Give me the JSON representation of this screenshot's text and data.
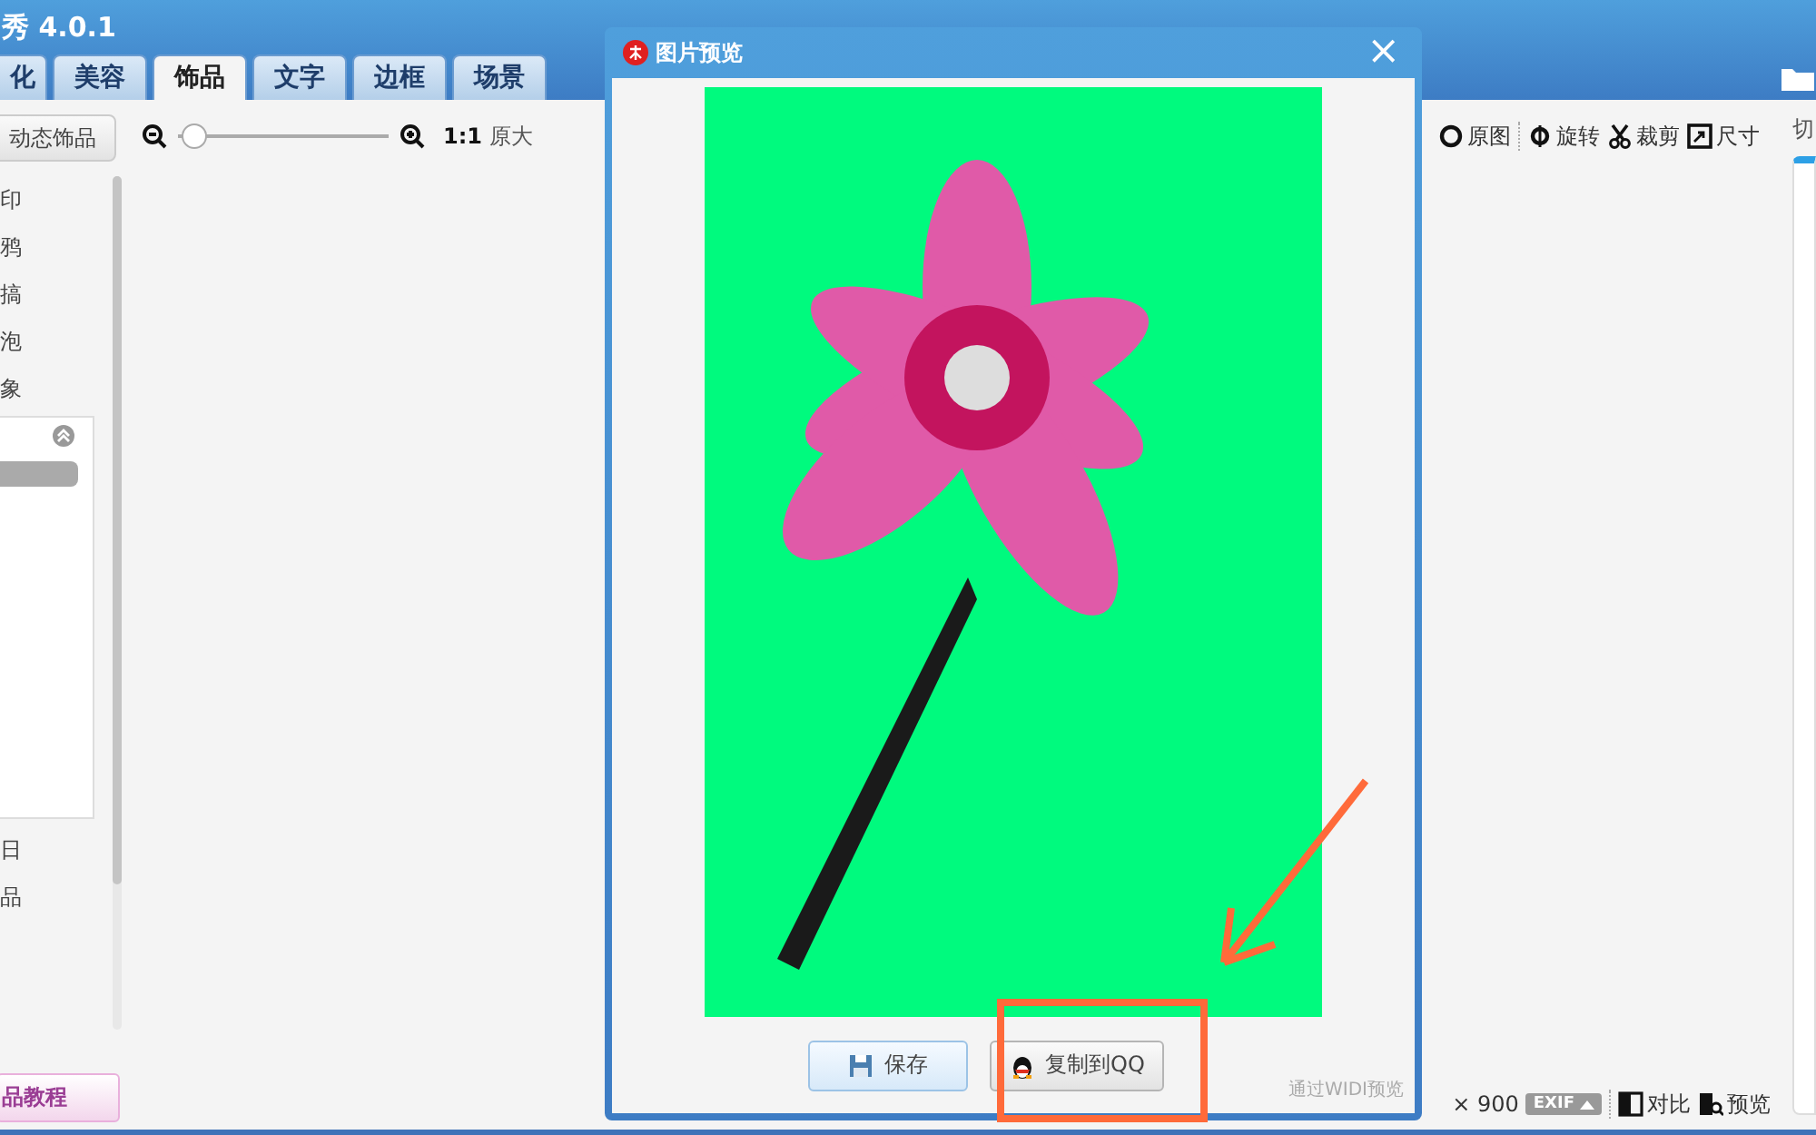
{
  "app": {
    "title": "秀 4.0.1",
    "tabs": [
      {
        "label": "化",
        "selected": false
      },
      {
        "label": "美容",
        "selected": false
      },
      {
        "label": "饰品",
        "selected": true
      },
      {
        "label": "文字",
        "selected": false
      },
      {
        "label": "边框",
        "selected": false
      },
      {
        "label": "场景",
        "selected": false
      }
    ]
  },
  "sidebar": {
    "top_button": "动态饰品",
    "items": [
      "印",
      "鸦",
      "搞",
      "泡",
      "象"
    ],
    "bottom_items": [
      "日",
      "品"
    ],
    "tutorial_button": "品教程"
  },
  "toolbar": {
    "zoom_slider": {
      "level": 0.02
    },
    "ratio": "1:1",
    "fit_label": "原大",
    "tools": [
      {
        "label": "原图",
        "kind": "original"
      },
      {
        "label": "旋转",
        "kind": "rotate"
      },
      {
        "label": "裁剪",
        "kind": "crop"
      },
      {
        "label": "尺寸",
        "kind": "resize"
      }
    ]
  },
  "right_panel": {
    "label": "切"
  },
  "status_bar": {
    "size": "× 900",
    "exif": "EXIF",
    "actions": [
      {
        "label": "对比",
        "kind": "compare"
      },
      {
        "label": "预览",
        "kind": "preview"
      }
    ]
  },
  "dialog": {
    "title": "图片预览",
    "close": "×",
    "buttons": [
      {
        "label": "保存",
        "kind": "save"
      },
      {
        "label": "复制到QQ",
        "kind": "qq"
      }
    ],
    "note": "通过WIDI预览"
  }
}
